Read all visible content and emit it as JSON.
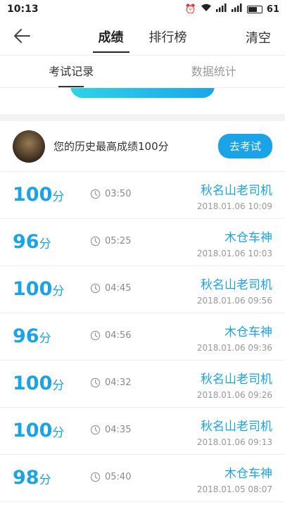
{
  "status_bar": {
    "time": "10:13",
    "battery": "61"
  },
  "nav": {
    "tabs": [
      "成绩",
      "排行榜"
    ],
    "clear_label": "清空"
  },
  "sub_tabs": [
    "考试记录",
    "数据统计"
  ],
  "best": {
    "text": "您的历史最高成绩100分",
    "button": "去考试"
  },
  "score_unit": "分",
  "records": [
    {
      "score": "100",
      "duration": "03:50",
      "name": "秋名山老司机",
      "date": "2018.01.06",
      "time": "10:09"
    },
    {
      "score": "96",
      "duration": "05:25",
      "name": "木仓车神",
      "date": "2018.01.06",
      "time": "10:03"
    },
    {
      "score": "100",
      "duration": "04:45",
      "name": "秋名山老司机",
      "date": "2018.01.06",
      "time": "09:56"
    },
    {
      "score": "96",
      "duration": "04:56",
      "name": "木仓车神",
      "date": "2018.01.06",
      "time": "09:36"
    },
    {
      "score": "100",
      "duration": "04:32",
      "name": "秋名山老司机",
      "date": "2018.01.06",
      "time": "09:26"
    },
    {
      "score": "100",
      "duration": "04:35",
      "name": "秋名山老司机",
      "date": "2018.01.06",
      "time": "09:13"
    },
    {
      "score": "98",
      "duration": "05:40",
      "name": "木仓车神",
      "date": "2018.01.05",
      "time": "08:07"
    }
  ],
  "colors": {
    "accent": "#1aa3e6",
    "banner_start": "#2ed3e6",
    "banner_end": "#1aa6ec"
  }
}
